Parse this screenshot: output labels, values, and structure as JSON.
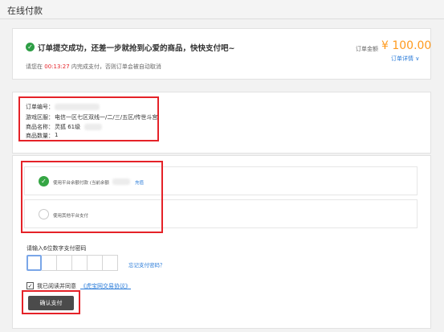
{
  "header": {
    "title": "在线付款"
  },
  "order": {
    "success_message": "订单提交成功，还差一步就抢到心爱的商品，快快支付吧~",
    "amount_label": "订单金额",
    "amount_value": "¥ 100.00",
    "details_link": "订单详情",
    "countdown_prefix": "请您在",
    "countdown_time": "00:13:27",
    "countdown_suffix": "内完成支付，否则订单会被自动取消",
    "info": {
      "order_no_label": "订单编号：",
      "server_label": "游戏区服：",
      "server_value": "电信一区七区双线一/二/三/五区/传世斗宫",
      "item_label": "商品名称：",
      "item_value": "灵狐 61级",
      "qty_label": "商品数量：",
      "qty_value": "1"
    }
  },
  "payment": {
    "balance_option": "使用平台余额付款 (当前余额",
    "recharge_link": "充值",
    "other_option": "使用其他平台支付"
  },
  "password": {
    "label": "请输入6位数字支付密码",
    "forgot_link": "忘记支付密码？"
  },
  "agreement": {
    "text": "我已阅读并同意",
    "link": "《虎宝网交易协议》"
  },
  "confirm_button": "确认支付",
  "colors": {
    "accent": "#ff9a1e",
    "link": "#2b7cd9",
    "success": "#2e9e45",
    "highlight": "#e52228"
  }
}
